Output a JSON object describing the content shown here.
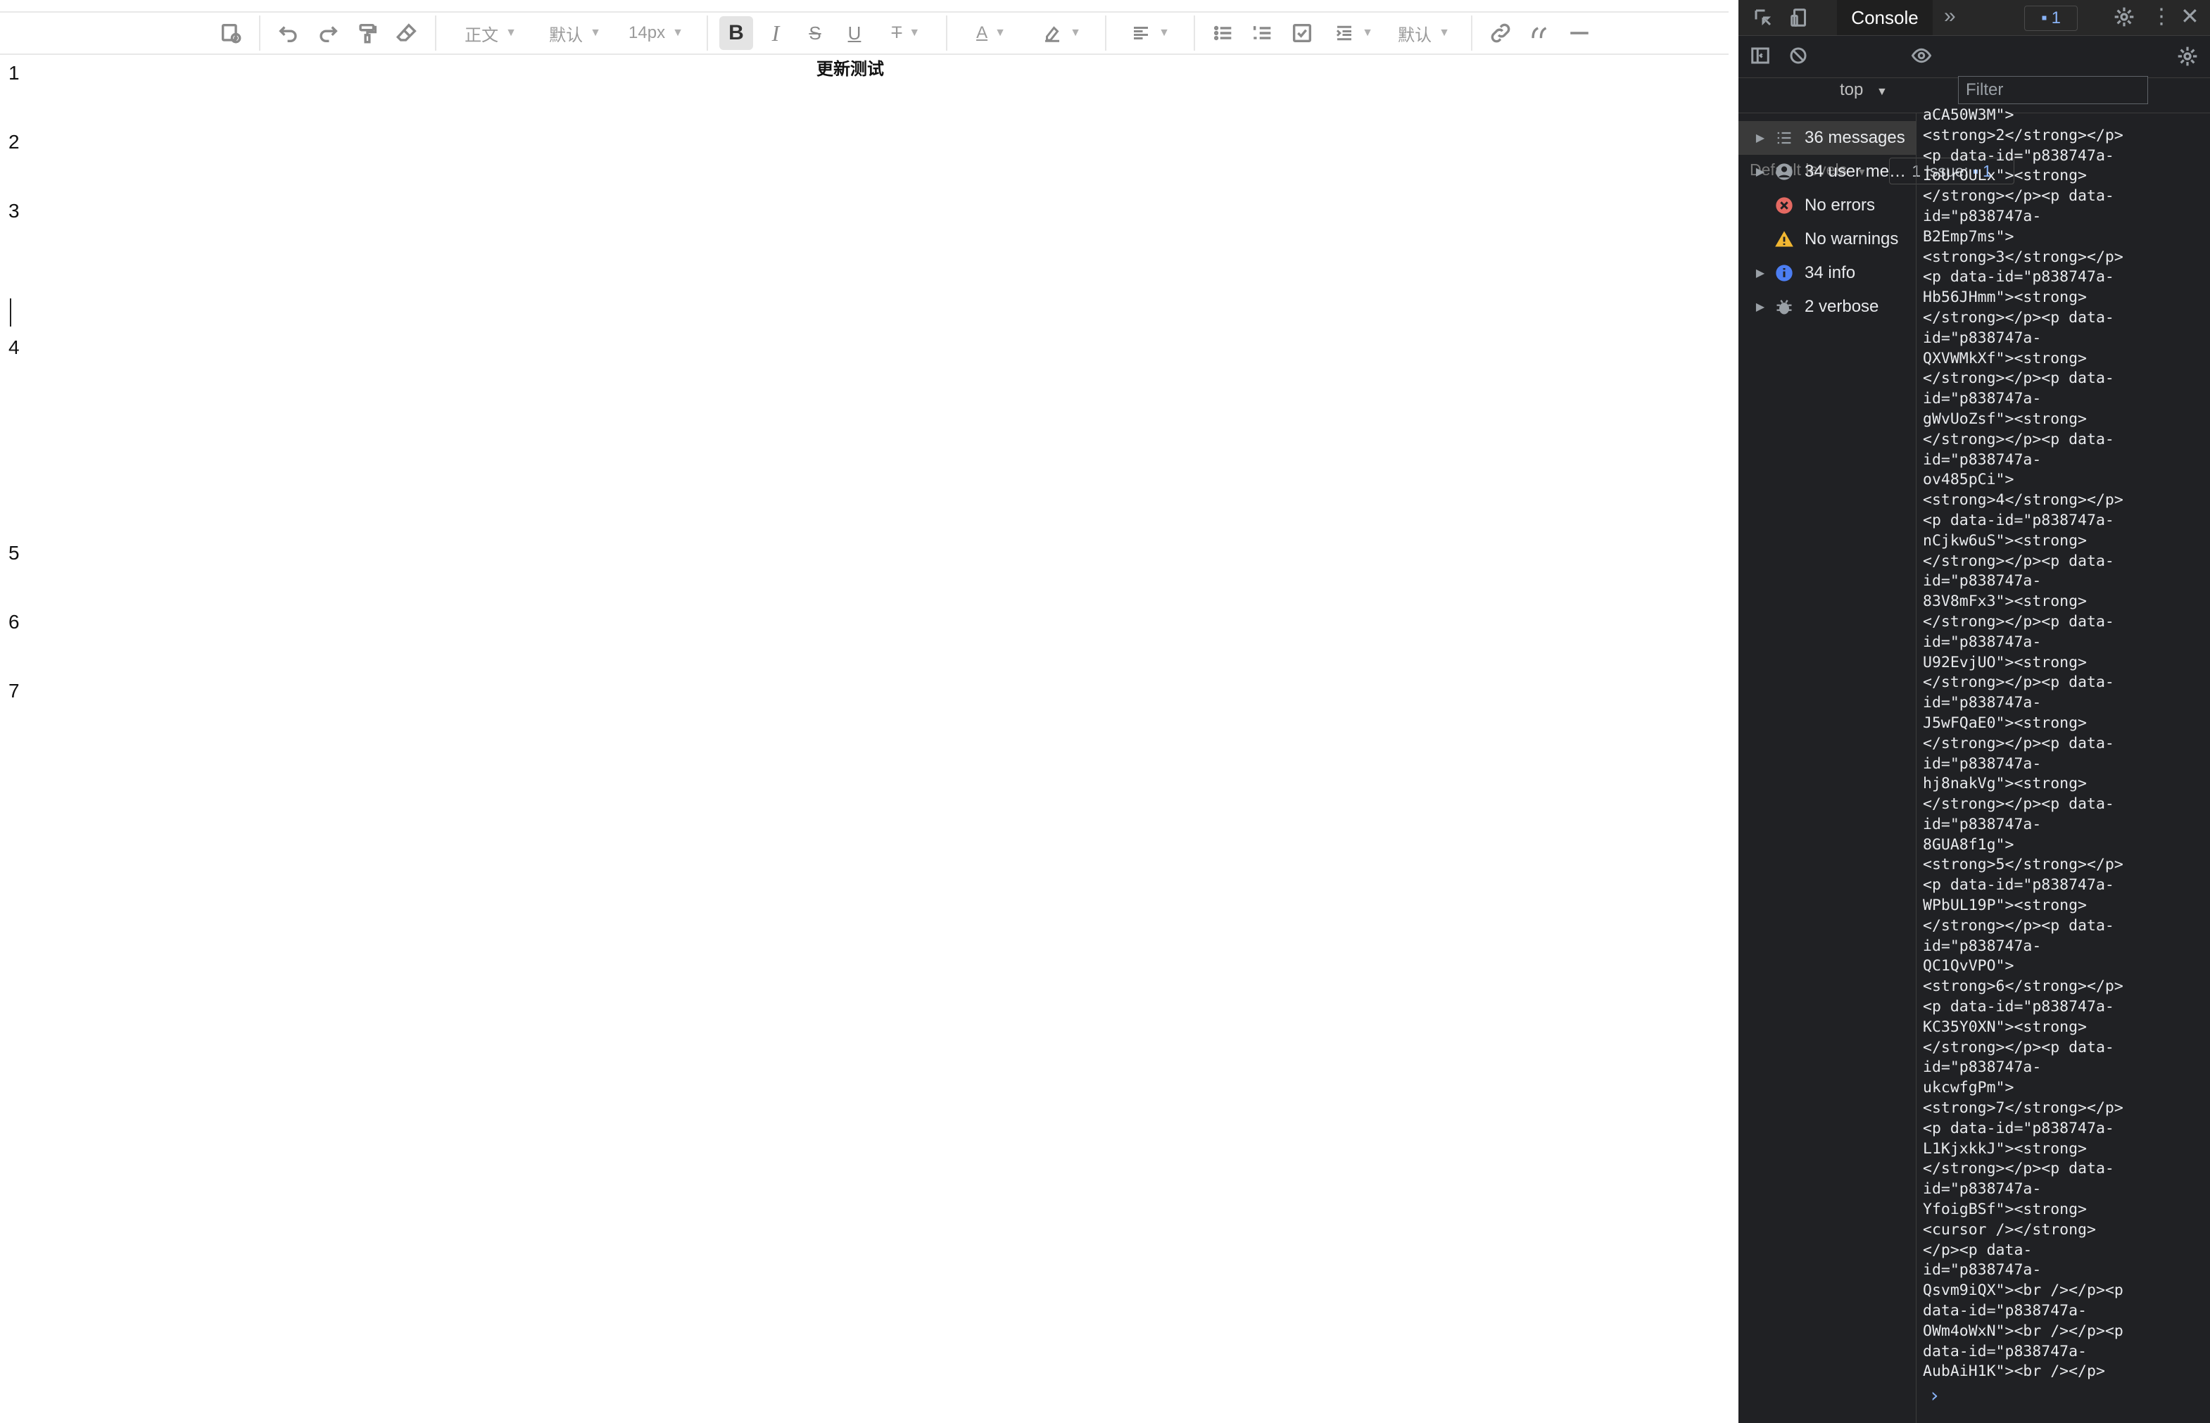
{
  "toolbar": {
    "paragraph_style": "正文",
    "font_family": "默认",
    "font_size": "14px",
    "bold_label": "B",
    "italic_label": "I",
    "strike_label": "S",
    "underline_label": "U",
    "clear_label": "T",
    "font_color_label": "A",
    "line_height": "默认"
  },
  "document": {
    "title": "更新测试",
    "lines": [
      "1",
      "2",
      "3",
      "4",
      "5",
      "6",
      "7"
    ]
  },
  "devtools": {
    "tab_console": "Console",
    "issue_count": "1",
    "context": "top",
    "filter_placeholder": "Filter",
    "levels": "Default levels",
    "issues_label": "1 Issue:",
    "issues_count": "1",
    "sidebar": [
      {
        "label": "36 messages",
        "icon": "list-icon"
      },
      {
        "label": "34 user me…",
        "icon": "user-icon"
      },
      {
        "label": "No errors",
        "icon": "error-icon"
      },
      {
        "label": "No warnings",
        "icon": "warning-icon"
      },
      {
        "label": "34 info",
        "icon": "info-icon"
      },
      {
        "label": "2 verbose",
        "icon": "bug-icon"
      }
    ],
    "log_lines": [
      "aCA50W3M\">",
      "<strong>2</strong></p>",
      "<p data-id=\"p838747a-",
      "IoUrOULx\"><strong>",
      "</strong></p><p data-",
      "id=\"p838747a-",
      "B2Emp7ms\">",
      "<strong>3</strong></p>",
      "<p data-id=\"p838747a-",
      "Hb56JHmm\"><strong>",
      "</strong></p><p data-",
      "id=\"p838747a-",
      "QXVWMkXf\"><strong>",
      "</strong></p><p data-",
      "id=\"p838747a-",
      "gWvUoZsf\"><strong>",
      "</strong></p><p data-",
      "id=\"p838747a-",
      "ov485pCi\">",
      "<strong>4</strong></p>",
      "<p data-id=\"p838747a-",
      "nCjkw6uS\"><strong>",
      "</strong></p><p data-",
      "id=\"p838747a-",
      "83V8mFx3\"><strong>",
      "</strong></p><p data-",
      "id=\"p838747a-",
      "U92EvjUO\"><strong>",
      "</strong></p><p data-",
      "id=\"p838747a-",
      "J5wFQaE0\"><strong>",
      "</strong></p><p data-",
      "id=\"p838747a-",
      "hj8nakVg\"><strong>",
      "</strong></p><p data-",
      "id=\"p838747a-",
      "8GUA8f1g\">",
      "<strong>5</strong></p>",
      "<p data-id=\"p838747a-",
      "WPbUL19P\"><strong>",
      "</strong></p><p data-",
      "id=\"p838747a-",
      "QC1QvVPO\">",
      "<strong>6</strong></p>",
      "<p data-id=\"p838747a-",
      "KC35Y0XN\"><strong>",
      "</strong></p><p data-",
      "id=\"p838747a-",
      "ukcwfgPm\">",
      "<strong>7</strong></p>",
      "<p data-id=\"p838747a-",
      "L1KjxkkJ\"><strong>",
      "</strong></p><p data-",
      "id=\"p838747a-",
      "YfoigBSf\"><strong>",
      "<cursor /></strong>",
      "</p><p data-",
      "id=\"p838747a-",
      "Qsvm9iQX\"><br /></p><p",
      "data-id=\"p838747a-",
      "OWm4oWxN\"><br /></p><p",
      "data-id=\"p838747a-",
      "AubAiH1K\"><br /></p>"
    ],
    "prompt": "›"
  }
}
